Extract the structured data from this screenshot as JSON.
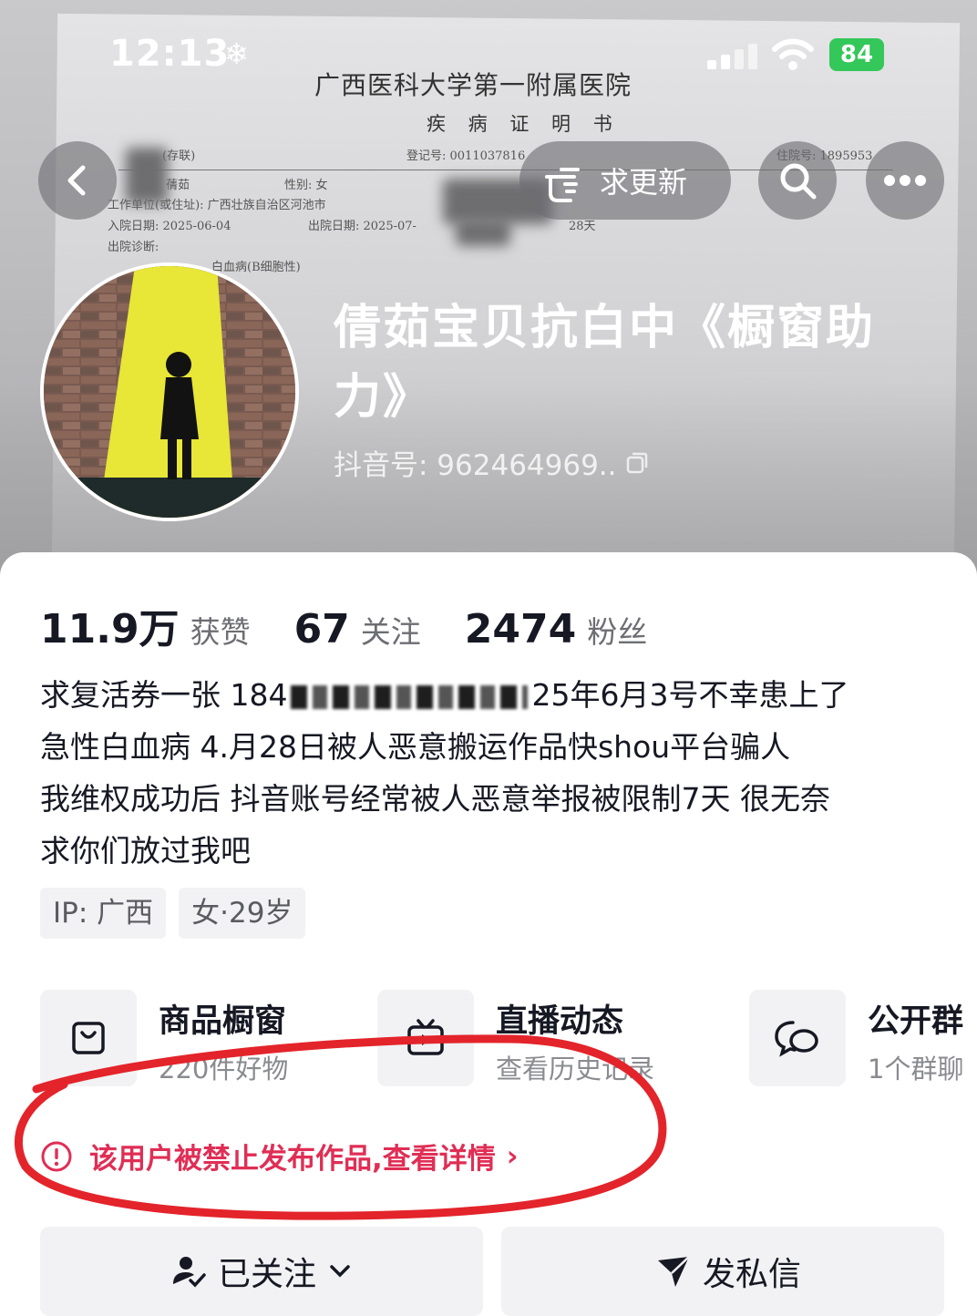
{
  "status_bar": {
    "time": "12:13",
    "weather_icon": "snowflake-icon",
    "battery": "84"
  },
  "background_doc": {
    "hospital": "广西医科大学第一附属医院",
    "doc_title": "疾 病 证 明 书",
    "copy_type": "(存联)",
    "reg_no": "登记号: 0011037816",
    "inpatient_no": "住院号: 1895953",
    "name_frag": "蒨茹",
    "gender": "性别: 女",
    "address": "工作单位(或住址): 广西壮族自治区河池市",
    "admit_date": "入院日期: 2025-06-04",
    "discharge_date": "出院日期: 2025-07-",
    "days": "28天",
    "diagnosis_label": "出院诊断:",
    "diagnosis": "白血病(B细胞性)"
  },
  "nav": {
    "back_icon": "chevron-left-icon",
    "update_label": "求更新",
    "search_icon": "search-icon",
    "more_icon": "more-icon"
  },
  "profile": {
    "title": "倩茹宝贝抗白中《橱窗助力》",
    "douyin_id": "抖音号: 962464969.."
  },
  "stats": [
    {
      "value": "11.9万",
      "label": "获赞"
    },
    {
      "value": "67",
      "label": "关注"
    },
    {
      "value": "2474",
      "label": "粉丝"
    }
  ],
  "bio": {
    "line1_a": "求复活券一张 184",
    "line1_b": "25年6月3号不幸患上了",
    "line2": "急性白血病 4.月28日被人恶意搬运作品快shou平台骗人",
    "line3": "我维权成功后 抖音账号经常被人恶意举报被限制7天 很无奈",
    "line4": "求你们放过我吧"
  },
  "tags": [
    "IP: 广西",
    "女·29岁"
  ],
  "features": [
    {
      "title": "商品橱窗",
      "subtitle": "220件好物",
      "icon": "shopping-bag-icon"
    },
    {
      "title": "直播动态",
      "subtitle": "查看历史记录",
      "icon": "tv-play-icon"
    },
    {
      "title": "公开群",
      "subtitle": "1个群聊",
      "icon": "chat-bubbles-icon"
    }
  ],
  "warning": {
    "text": "该用户被禁止发布作品,查看详情",
    "arrow": "›"
  },
  "actions": {
    "follow": "已关注",
    "message": "发私信"
  },
  "colors": {
    "warning": "#e02e55",
    "annotation": "#e3242b",
    "battery": "#34c759"
  }
}
